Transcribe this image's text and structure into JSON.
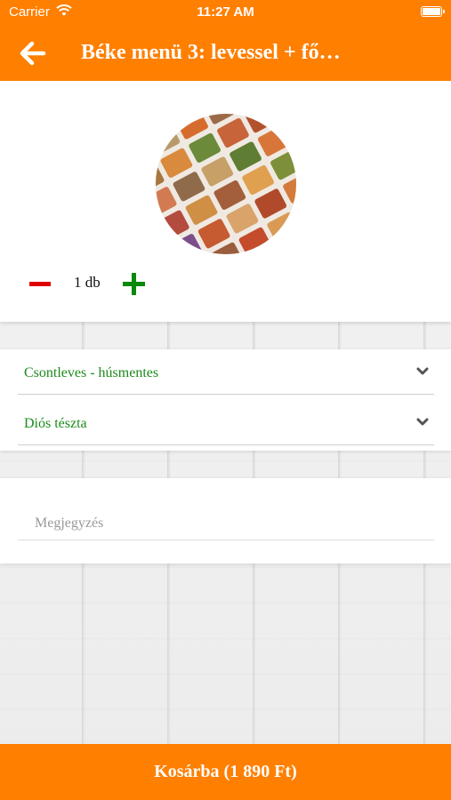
{
  "status": {
    "carrier": "Carrier",
    "time": "11:27 AM"
  },
  "nav": {
    "title": "Béke menü 3: levessel + fő…"
  },
  "product": {
    "quantity_label": "1 db"
  },
  "options": [
    {
      "label": "Csontleves - húsmentes"
    },
    {
      "label": "Diós tészta"
    }
  ],
  "note": {
    "placeholder": "Megjegyzés",
    "value": ""
  },
  "cart": {
    "button_label": "Kosárba (1 890 Ft)"
  },
  "colors": {
    "brand": "#ff7f00",
    "option_text": "#1c8a1c",
    "minus": "#e00000",
    "plus": "#0a8a0a"
  }
}
